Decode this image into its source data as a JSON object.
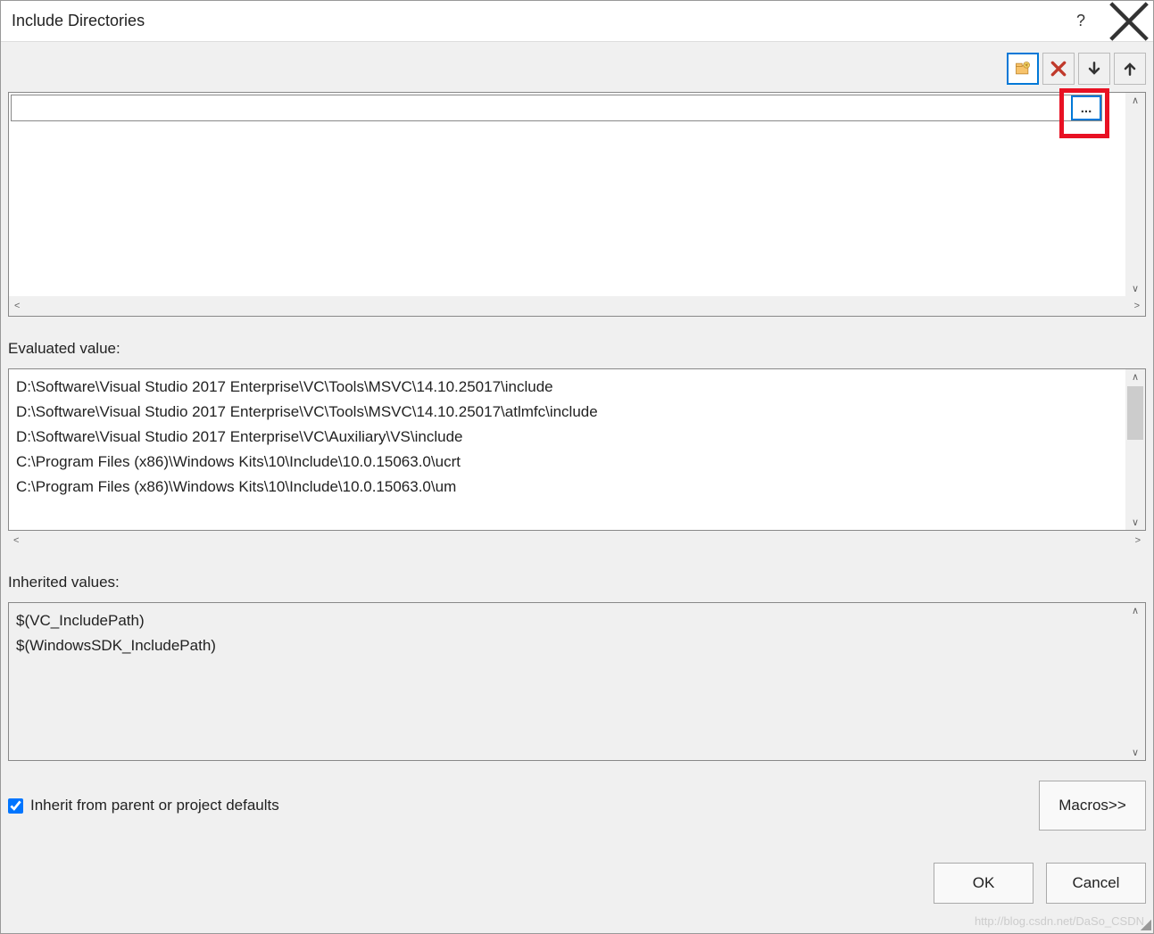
{
  "title": "Include Directories",
  "toolbar": {
    "new_folder": "new-folder",
    "delete": "delete",
    "move_down": "move-down",
    "move_up": "move-up"
  },
  "editor": {
    "input_value": "",
    "browse_label": "..."
  },
  "evaluated": {
    "label": "Evaluated value:",
    "lines": [
      "D:\\Software\\Visual Studio 2017 Enterprise\\VC\\Tools\\MSVC\\14.10.25017\\include",
      "D:\\Software\\Visual Studio 2017 Enterprise\\VC\\Tools\\MSVC\\14.10.25017\\atlmfc\\include",
      "D:\\Software\\Visual Studio 2017 Enterprise\\VC\\Auxiliary\\VS\\include",
      "C:\\Program Files (x86)\\Windows Kits\\10\\Include\\10.0.15063.0\\ucrt",
      "C:\\Program Files (x86)\\Windows Kits\\10\\Include\\10.0.15063.0\\um"
    ]
  },
  "inherited": {
    "label": "Inherited values:",
    "lines": [
      "$(VC_IncludePath)",
      "$(WindowsSDK_IncludePath)"
    ]
  },
  "checkbox": {
    "label": "Inherit from parent or project defaults",
    "checked": true
  },
  "buttons": {
    "macros": "Macros>>",
    "ok": "OK",
    "cancel": "Cancel"
  },
  "watermark": "http://blog.csdn.net/DaSo_CSDN"
}
